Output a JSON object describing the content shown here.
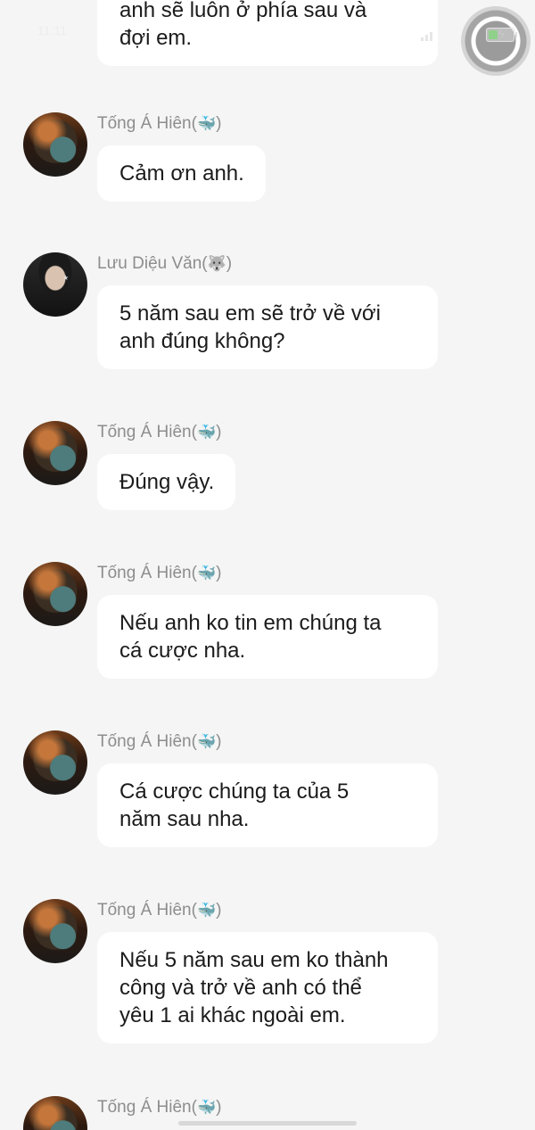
{
  "status_bar": {
    "time_ghost": "11:11",
    "battery_label": "battery",
    "assistive_touch": "assistive-touch"
  },
  "chat": {
    "partial_bubble": [
      "anh sẽ luôn ở phía sau và",
      "đợi em."
    ],
    "messages": [
      {
        "sender": "Tống Á Hiên",
        "sender_icon": "🐳",
        "avatar": "a",
        "lines": [
          "Cảm ơn anh."
        ]
      },
      {
        "sender": "Lưu Diệu Văn",
        "sender_icon": "🐺",
        "avatar": "b",
        "lines": [
          "5 năm sau em sẽ trở về với",
          "anh đúng không?"
        ]
      },
      {
        "sender": "Tống Á Hiên",
        "sender_icon": "🐳",
        "avatar": "a",
        "lines": [
          "Đúng vậy."
        ]
      },
      {
        "sender": "Tống Á Hiên",
        "sender_icon": "🐳",
        "avatar": "a",
        "lines": [
          "Nếu anh ko tin em chúng ta",
          "cá cược nha."
        ]
      },
      {
        "sender": "Tống Á Hiên",
        "sender_icon": "🐳",
        "avatar": "a",
        "lines": [
          "Cá cược chúng ta của 5",
          "năm sau nha."
        ]
      },
      {
        "sender": "Tống Á Hiên",
        "sender_icon": "🐳",
        "avatar": "a",
        "lines": [
          "Nếu 5 năm sau em ko thành",
          "công và trở về anh có thể",
          "yêu 1 ai khác ngoài em."
        ]
      },
      {
        "sender": "Tống Á Hiên",
        "sender_icon": "🐳",
        "avatar": "a",
        "lines": []
      }
    ]
  }
}
